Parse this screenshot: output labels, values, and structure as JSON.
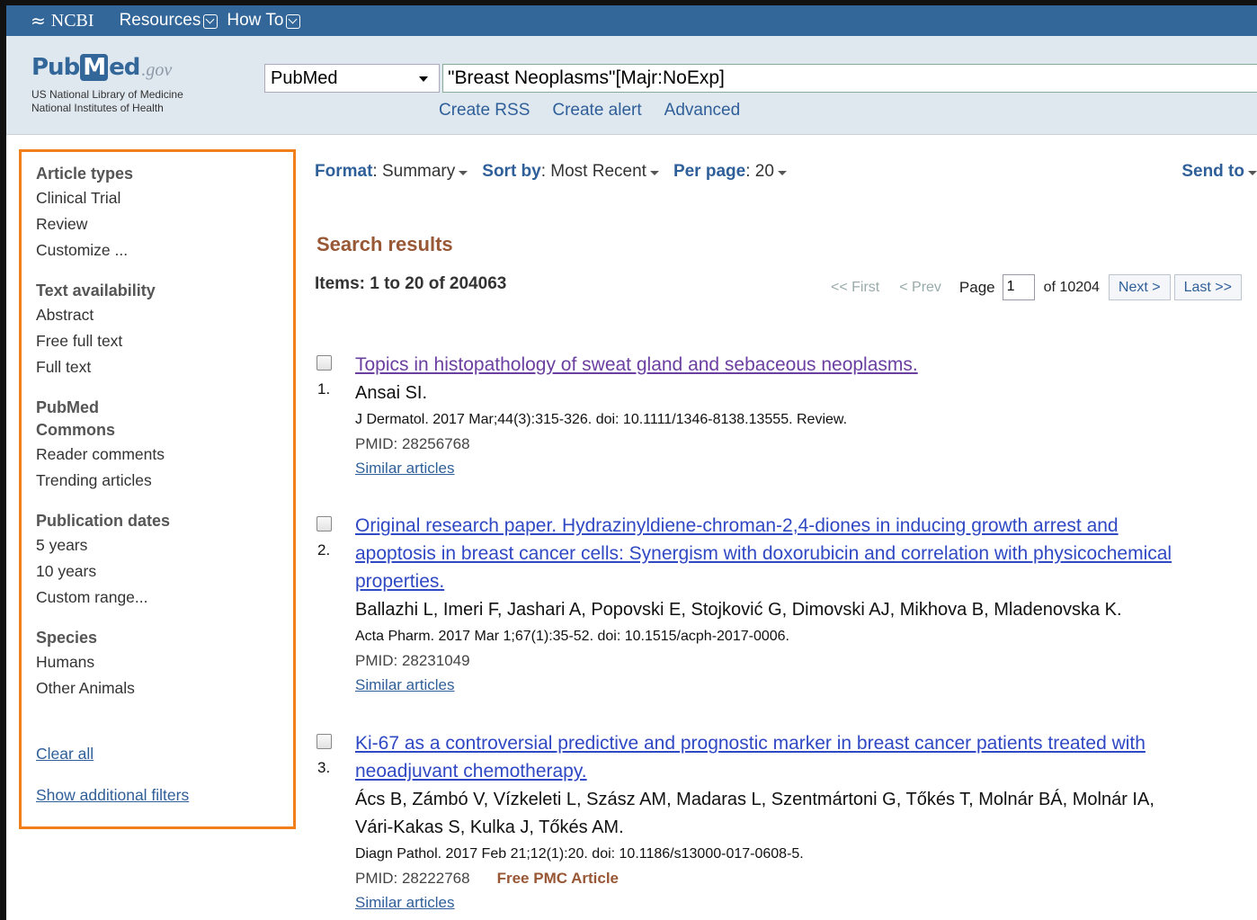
{
  "topbar": {
    "brand": "NCBI",
    "resources": "Resources",
    "howto": "How To"
  },
  "header": {
    "logo_pub": "Pub",
    "logo_m": "M",
    "logo_ed": "ed",
    "logo_gov": ".gov",
    "line1": "US National Library of Medicine",
    "line2": "National Institutes of Health",
    "database": "PubMed",
    "query": "\"Breast Neoplasms\"[Majr:NoExp]",
    "links": [
      "Create RSS",
      "Create alert",
      "Advanced"
    ]
  },
  "sidebar": {
    "groups": [
      {
        "title": "Article types",
        "items": [
          "Clinical Trial",
          "Review",
          "Customize ..."
        ]
      },
      {
        "title": "Text availability",
        "items": [
          "Abstract",
          "Free full text",
          "Full text"
        ]
      },
      {
        "title": "PubMed Commons",
        "items": [
          "Reader comments",
          "Trending articles"
        ]
      },
      {
        "title": "Publication dates",
        "items": [
          "5 years",
          "10 years",
          "Custom range..."
        ]
      },
      {
        "title": "Species",
        "items": [
          "Humans",
          "Other Animals"
        ]
      }
    ],
    "clear_all": "Clear all",
    "show_more": "Show additional filters"
  },
  "toolbar": {
    "format_label": "Format",
    "format_value": ": Summary",
    "sort_label": "Sort by",
    "sort_value": ": Most Recent",
    "perpage_label": "Per page",
    "perpage_value": ": 20",
    "send_to": "Send to"
  },
  "results": {
    "title": "Search results",
    "count": "Items: 1 to 20 of 204063",
    "pager": {
      "first": "<< First",
      "prev": "< Prev",
      "page_label": "Page",
      "page_value": "1",
      "of": "of 10204",
      "next": "Next >",
      "last": "Last >>"
    },
    "items": [
      {
        "num": "1.",
        "title_lines": [
          "Topics in histopathology of sweat gland and sebaceous neoplasms."
        ],
        "authors_lines": [
          "Ansai SI."
        ],
        "journal": "J Dermatol. 2017 Mar;44(3):315-326. doi: 10.1111/1346-8138.13555. Review.",
        "pmid": "PMID: 28256768",
        "free": "",
        "similar": "Similar articles"
      },
      {
        "num": "2.",
        "title_lines": [
          "Original research paper. Hydrazinyldiene-chroman-2,4-diones in inducing growth arrest and",
          "apoptosis in breast cancer cells: Synergism with doxorubicin and correlation with physicochemical",
          "properties."
        ],
        "authors_lines": [
          "Ballazhi L, Imeri F, Jashari A, Popovski E, Stojković G, Dimovski AJ, Mikhova B, Mladenovska K."
        ],
        "journal": "Acta Pharm. 2017 Mar 1;67(1):35-52. doi: 10.1515/acph-2017-0006.",
        "pmid": "PMID: 28231049",
        "free": "",
        "similar": "Similar articles"
      },
      {
        "num": "3.",
        "title_lines": [
          "Ki-67 as a controversial predictive and prognostic marker in breast cancer patients treated with",
          "neoadjuvant chemotherapy."
        ],
        "authors_lines": [
          "Ács B, Zámbó V, Vízkeleti L, Szász AM, Madaras L, Szentmártoni G, Tőkés T, Molnár BÁ, Molnár IA,",
          "Vári-Kakas S, Kulka J, Tőkés AM."
        ],
        "journal": "Diagn Pathol. 2017 Feb 21;12(1):20. doi: 10.1186/s13000-017-0608-5.",
        "pmid": "PMID: 28222768",
        "free": "Free PMC Article",
        "similar": "Similar articles"
      }
    ]
  },
  "colors": {
    "ncbi_bar": "#336699",
    "link": "#2f5f99",
    "result_title": "#2f48c3",
    "visited": "#6b3fa0",
    "heading_brown": "#985735",
    "sidebar_highlight": "#f07f1a"
  }
}
